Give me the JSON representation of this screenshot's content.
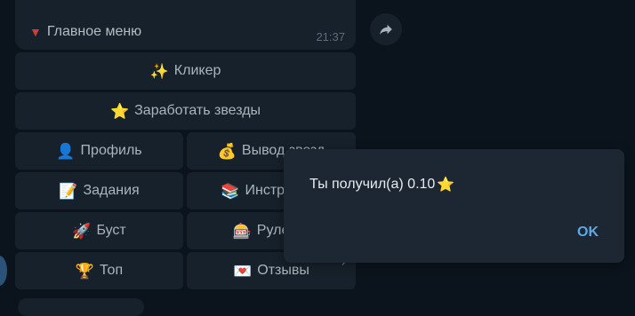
{
  "message": {
    "text": "Главное меню",
    "icon": "red-triangle-down-icon",
    "time": "21:37"
  },
  "share": {
    "icon": "share-arrow-icon"
  },
  "keyboard": {
    "rows": [
      [
        {
          "icon": "✨",
          "label": "Кликер"
        }
      ],
      [
        {
          "icon": "⭐",
          "label": "Заработать звезды"
        }
      ],
      [
        {
          "icon": "👤",
          "label": "Профиль"
        },
        {
          "icon": "💰",
          "label": "Вывод звезд"
        }
      ],
      [
        {
          "icon": "📝",
          "label": "Задания"
        },
        {
          "icon": "📚",
          "label": "Инструкция"
        }
      ],
      [
        {
          "icon": "🚀",
          "label": "Буст"
        },
        {
          "icon": "🎰",
          "label": "Рулетка"
        }
      ],
      [
        {
          "icon": "🏆",
          "label": "Топ"
        },
        {
          "icon": "💌",
          "label": "Отзывы"
        }
      ]
    ],
    "corner_mark": "↗"
  },
  "dialog": {
    "message": "Ты получил(а) 0.10",
    "icon": "⭐",
    "ok_label": "OK"
  },
  "colors": {
    "background": "#0b141c",
    "bubble": "#17212b",
    "dialog": "#1c2733",
    "accent": "#5ea9e4"
  }
}
